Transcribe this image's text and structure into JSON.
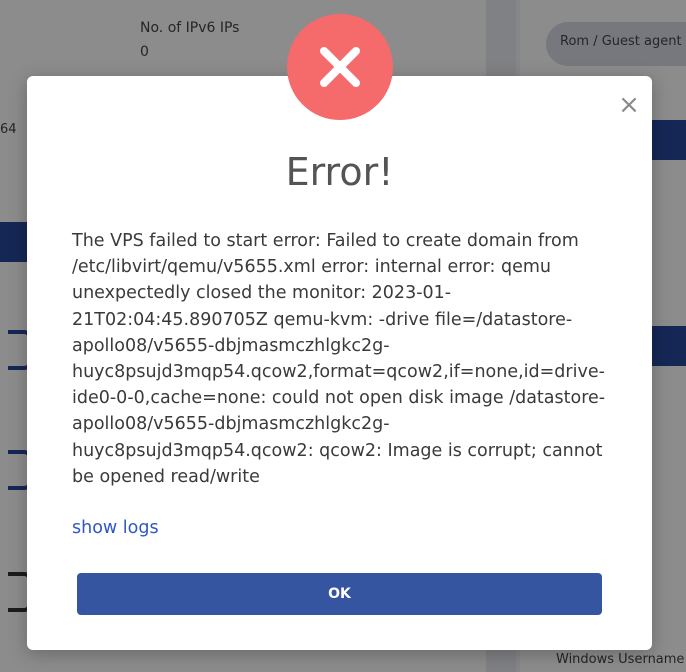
{
  "background": {
    "ipv6_label": "No. of IPv6 IPs",
    "ipv6_value": "0",
    "pill_text": "Rom / Guest agent",
    "left_fragment": "64",
    "footer_text": "Windows Username"
  },
  "dialog": {
    "title": "Error!",
    "message": "The VPS failed to start error: Failed to create domain from /etc/libvirt/qemu/v5655.xml error: internal error: qemu unexpectedly closed the monitor: 2023-01-21T02:04:45.890705Z qemu-kvm: -drive file=/datastore-apollo08/v5655-dbjmasmczhlgkc2g-huyc8psujd3mqp54.qcow2,format=qcow2,if=none,id=drive-ide0-0-0,cache=none: could not open disk image /datastore-apollo08/v5655-dbjmasmczhlgkc2g-huyc8psujd3mqp54.qcow2: qcow2: Image is corrupt; cannot be opened read/write",
    "show_logs_label": "show logs",
    "ok_label": "OK",
    "close_symbol": "×"
  },
  "icons": {
    "error": "x-circle-icon",
    "close": "close-icon"
  },
  "colors": {
    "error_circle": "#f56a6a",
    "ok_button": "#3555a1",
    "link": "#2f57c2",
    "title": "#545454"
  }
}
